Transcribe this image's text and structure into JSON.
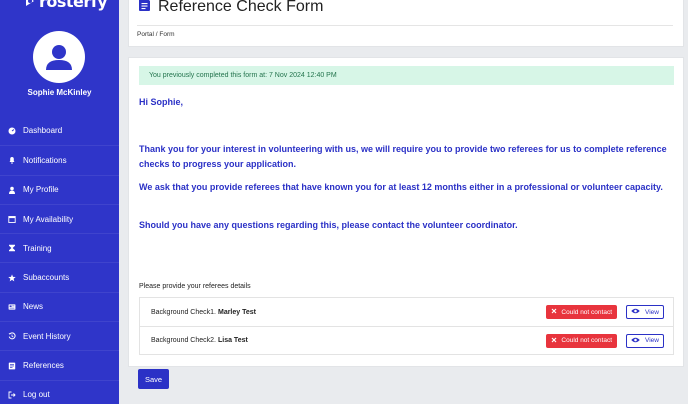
{
  "app": {
    "logo_text": "rosterfy",
    "user_name": "Sophie McKinley"
  },
  "sidebar": {
    "items": [
      {
        "label": "Dashboard",
        "icon": "dashboard-icon"
      },
      {
        "label": "Notifications",
        "icon": "bell-icon"
      },
      {
        "label": "My Profile",
        "icon": "user-icon"
      },
      {
        "label": "My Availability",
        "icon": "calendar-icon"
      },
      {
        "label": "Training",
        "icon": "training-icon"
      },
      {
        "label": "Subaccounts",
        "icon": "star-icon"
      },
      {
        "label": "News",
        "icon": "news-icon"
      },
      {
        "label": "Event History",
        "icon": "history-icon"
      },
      {
        "label": "References",
        "icon": "references-icon"
      },
      {
        "label": "Log out",
        "icon": "logout-icon"
      }
    ]
  },
  "header": {
    "title": "Reference Check Form",
    "breadcrumb": "Portal  /  Form"
  },
  "form": {
    "alert": "You previously completed this form at: 7 Nov 2024 12:40 PM",
    "greeting": "Hi Sophie,",
    "paragraph1": "Thank you for your interest in volunteering with us, we will require you to provide two referees for us to complete reference checks to progress your application.",
    "paragraph2": "We ask that you provide referees that have known you for at least 12 months either in a professional or volunteer capacity.",
    "paragraph3": "Should you have any questions regarding this, please contact the volunteer coordinator.",
    "referees_label": "Please provide your referees details",
    "referees": [
      {
        "prefix": "Background Check1.",
        "name": "Marley Test",
        "status": "Could not contact",
        "action": "View"
      },
      {
        "prefix": "Background Check2.",
        "name": "Lisa Test",
        "status": "Could not contact",
        "action": "View"
      }
    ],
    "save_label": "Save"
  },
  "colors": {
    "brand": "#2f35c9",
    "danger": "#e8343d",
    "success_bg": "#d7f6e7",
    "success_text": "#23744d"
  }
}
